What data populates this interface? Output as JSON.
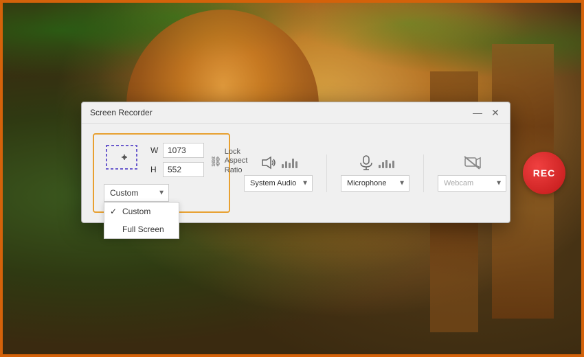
{
  "window": {
    "title": "Screen Recorder",
    "minimize_label": "—",
    "close_label": "✕"
  },
  "capture": {
    "width_label": "W",
    "height_label": "H",
    "width_value": "1073",
    "height_value": "552",
    "mode_select": {
      "selected": "Custom",
      "options": [
        "Custom",
        "Full Screen"
      ]
    },
    "lock_aspect_label": "Lock Aspect\nRatio",
    "dropdown": {
      "custom_label": "Custom",
      "fullscreen_label": "Full Screen"
    }
  },
  "audio": {
    "system_audio_label": "System Audio",
    "microphone_label": "Microphone",
    "webcam_label": "Webcam"
  },
  "rec_button_label": "REC",
  "colors": {
    "accent_orange": "#e8a030",
    "rec_red": "#c01818",
    "border_orange": "#d4620a"
  }
}
